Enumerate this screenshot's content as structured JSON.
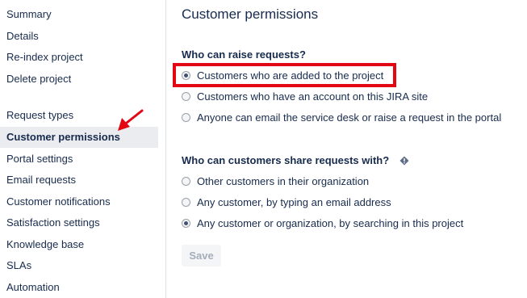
{
  "sidebar": {
    "items": [
      {
        "label": "Summary"
      },
      {
        "label": "Details"
      },
      {
        "label": "Re-index project"
      },
      {
        "label": "Delete project"
      },
      {
        "label": "Request types"
      },
      {
        "label": "Customer permissions",
        "selected": true
      },
      {
        "label": "Portal settings"
      },
      {
        "label": "Email requests"
      },
      {
        "label": "Customer notifications"
      },
      {
        "label": "Satisfaction settings"
      },
      {
        "label": "Knowledge base"
      },
      {
        "label": "SLAs"
      },
      {
        "label": "Automation"
      }
    ]
  },
  "main": {
    "title": "Customer permissions",
    "raise_section": {
      "title": "Who can raise requests?",
      "options": [
        {
          "label": "Customers who are added to the project",
          "checked": true
        },
        {
          "label": "Customers who have an account on this JIRA site",
          "checked": false
        },
        {
          "label": "Anyone can email the service desk or raise a request in the portal",
          "checked": false
        }
      ]
    },
    "share_section": {
      "title": "Who can customers share requests with?",
      "help_icon": "warning-diamond-icon",
      "options": [
        {
          "label": "Other customers in their organization",
          "checked": false
        },
        {
          "label": "Any customer, by typing an email address",
          "checked": false
        },
        {
          "label": "Any customer or organization, by searching in this project",
          "checked": true
        }
      ]
    },
    "save_label": "Save"
  },
  "colors": {
    "annotation": "#e30613",
    "selected_bg": "#ebecf0",
    "text": "#172b4d",
    "disabled_text": "#a5adba"
  }
}
